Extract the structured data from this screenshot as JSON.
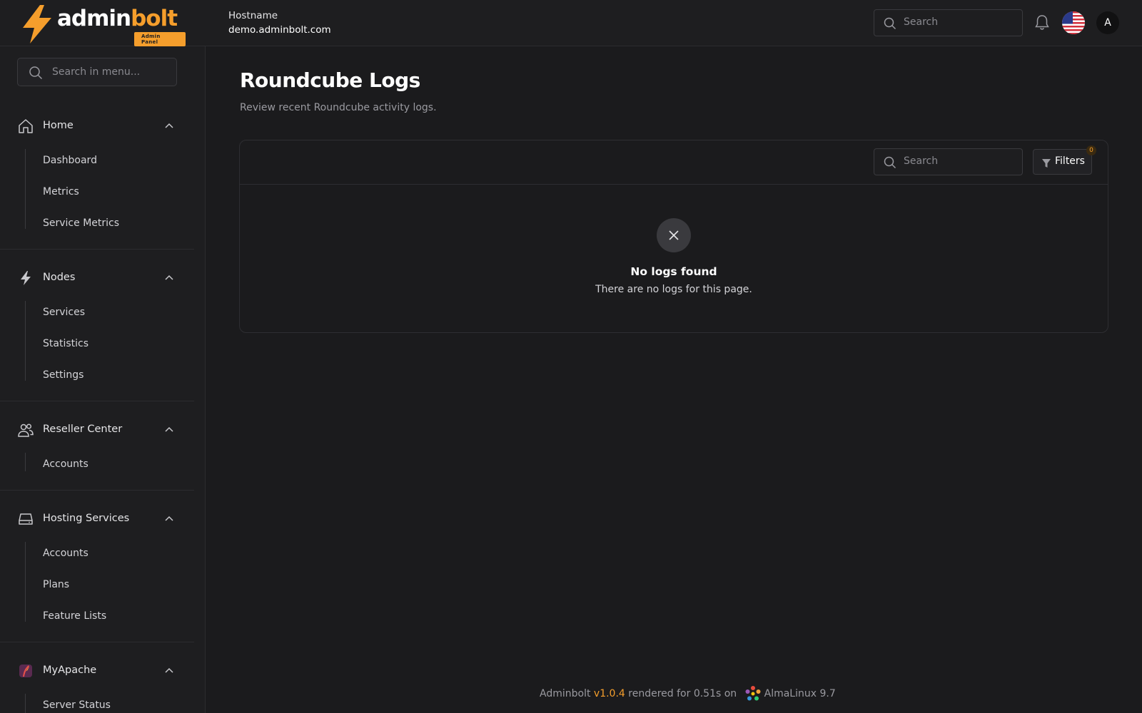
{
  "header": {
    "logo_text_main": "admin",
    "logo_text_accent": "bolt",
    "logo_badge": "Admin Panel",
    "hostname_label": "Hostname",
    "hostname_value": "demo.adminbolt.com",
    "search_placeholder": "Search",
    "avatar_initial": "A",
    "icons": [
      "bell-icon",
      "us-flag-icon",
      "search-icon"
    ]
  },
  "sidebar": {
    "search_placeholder": "Search in menu...",
    "groups": [
      {
        "label": "Home",
        "icon": "home-icon",
        "items": [
          "Dashboard",
          "Metrics",
          "Service Metrics"
        ]
      },
      {
        "label": "Nodes",
        "icon": "bolt-icon",
        "items": [
          "Services",
          "Statistics",
          "Settings"
        ]
      },
      {
        "label": "Reseller Center",
        "icon": "users-icon",
        "items": [
          "Accounts"
        ]
      },
      {
        "label": "Hosting Services",
        "icon": "server-icon",
        "items": [
          "Accounts",
          "Plans",
          "Feature Lists"
        ]
      },
      {
        "label": "MyApache",
        "icon": "apache-feather-icon",
        "items": [
          "Server Status"
        ]
      }
    ]
  },
  "main": {
    "title": "Roundcube Logs",
    "subtitle": "Review recent Roundcube activity logs.",
    "table": {
      "search_placeholder": "Search",
      "filters_label": "Filters",
      "filters_count": "0",
      "empty_title": "No logs found",
      "empty_subtitle": "There are no logs for this page."
    }
  },
  "footer": {
    "app_name": "Adminbolt",
    "version": "v1.0.4",
    "render_text": "rendered for 0.51s on",
    "os": "AlmaLinux 9.7"
  },
  "colors": {
    "accent": "#f59e2c",
    "background": "#1b1b1d",
    "panel": "#1e1e20",
    "border": "#2e2e32"
  }
}
